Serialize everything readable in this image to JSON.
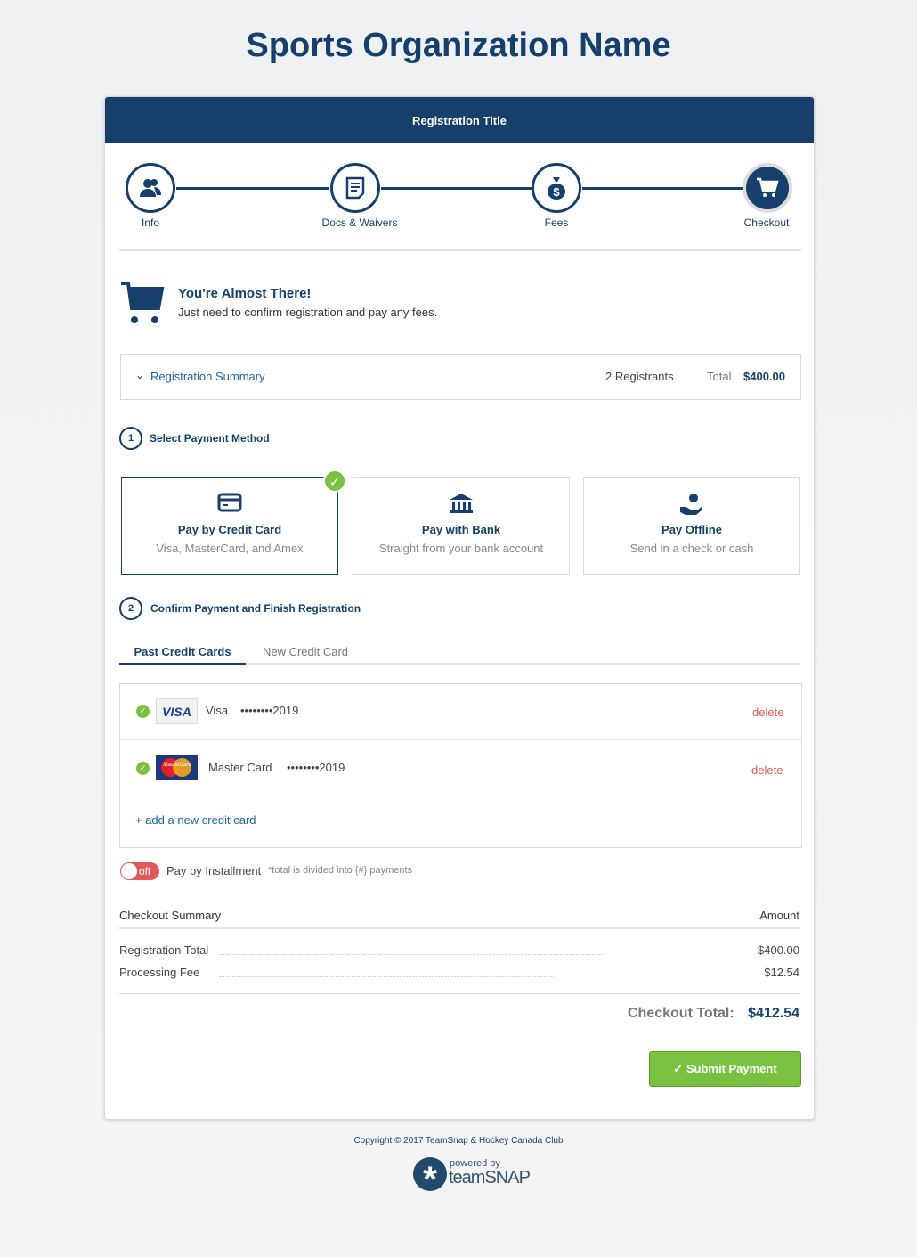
{
  "org_name": "Sports Organization Name",
  "header_title": "Registration Title",
  "steps": [
    {
      "label": "Info",
      "icon": "users-icon"
    },
    {
      "label": "Docs & Waivers",
      "icon": "document-icon"
    },
    {
      "label": "Fees",
      "icon": "money-bag-icon"
    },
    {
      "label": "Checkout",
      "icon": "cart-icon"
    }
  ],
  "intro": {
    "title": "You're Almost There!",
    "subtitle": "Just need to confirm registration and pay any fees."
  },
  "summary": {
    "label": "Registration Summary",
    "registrants": "2 Registrants",
    "total_label": "Total",
    "total_value": "$400.00"
  },
  "section1": {
    "num": "1",
    "label": "Select Payment Method"
  },
  "methods": [
    {
      "title": "Pay by Credit Card",
      "sub": "Visa, MasterCard, and Amex",
      "selected": true
    },
    {
      "title": "Pay with Bank",
      "sub": "Straight from your bank account"
    },
    {
      "title": "Pay Offline",
      "sub": "Send in a check or cash"
    }
  ],
  "section2": {
    "num": "2",
    "label": "Confirm Payment and Finish Registration"
  },
  "tabs": [
    {
      "label": "Past Credit Cards",
      "active": true
    },
    {
      "label": "New Credit Card"
    }
  ],
  "cards": [
    {
      "brand": "Visa",
      "logo": "VISA",
      "masked": "••••••••2019",
      "delete": "delete"
    },
    {
      "brand": "Master Card",
      "logo": "MasterCard",
      "masked": "••••••••2019",
      "delete": "delete"
    }
  ],
  "add_card": "+ add a new credit card",
  "installment": {
    "toggle": "off",
    "label": "Pay by Installment",
    "note": "*total is divided into {#} payments"
  },
  "checkout": {
    "title": "Checkout Summary",
    "amount_header": "Amount",
    "rows": [
      {
        "label": "Registration Total",
        "value": "$400.00"
      },
      {
        "label": "Processing Fee",
        "value": "$12.54"
      }
    ],
    "total_label": "Checkout Total:",
    "total_value": "$412.54"
  },
  "submit": "Submit Payment",
  "footer": {
    "copyright": "Copyright © 2017 TeamSnap & Hockey Canada Club",
    "powered": "powered by",
    "brand": "teamSNAP"
  },
  "colors": {
    "navy": "#16406b",
    "green": "#7ac142",
    "red": "#e05a5a"
  }
}
